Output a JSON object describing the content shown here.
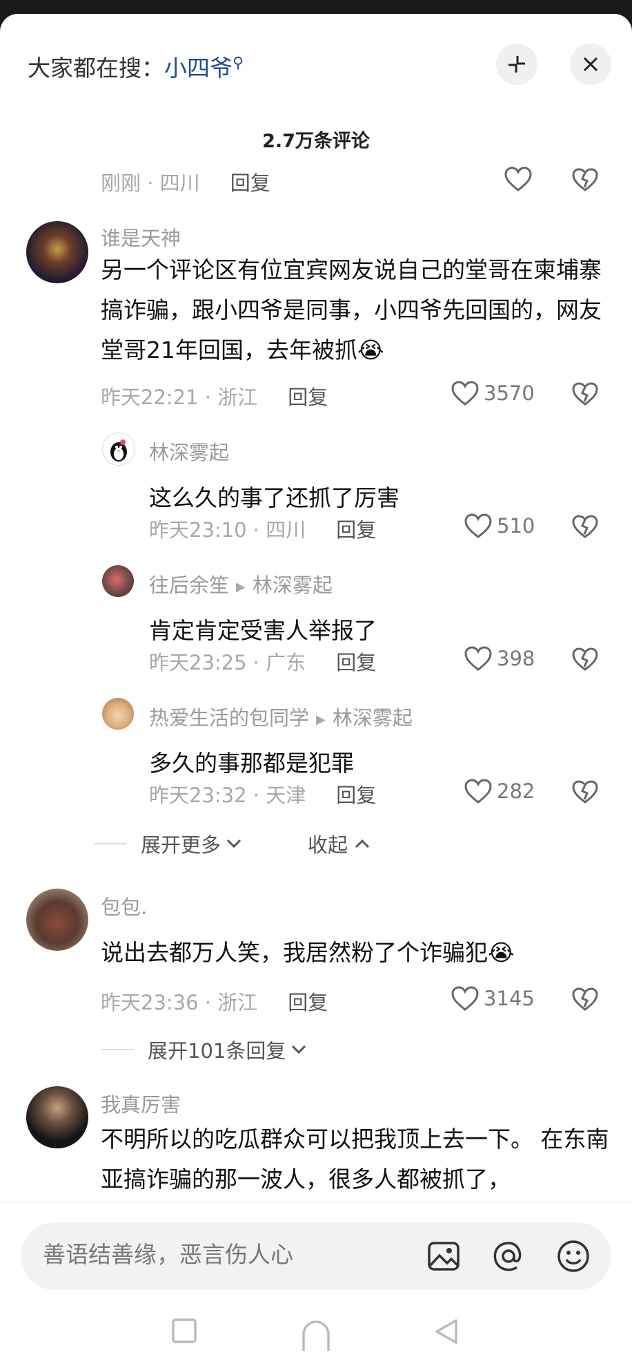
{
  "header": {
    "search_prefix": "大家都在搜：",
    "search_query": "小四爷"
  },
  "comment_count": "2.7万条评论",
  "top_meta": {
    "time": "刚刚",
    "location": "四川",
    "reply": "回复"
  },
  "comments": [
    {
      "user": "谁是天神",
      "text": "另一个评论区有位宜宾网友说自己的堂哥在柬埔寨搞诈骗，跟小四爷是同事，小四爷先回国的，网友堂哥21年回国，去年被抓",
      "emoji": "😭",
      "time": "昨天22:21",
      "location": "浙江",
      "reply": "回复",
      "likes": "3570",
      "replies": [
        {
          "user": "林深雾起",
          "reply_to": "",
          "text": "这么久的事了还抓了厉害",
          "time": "昨天23:10",
          "location": "四川",
          "reply": "回复",
          "likes": "510"
        },
        {
          "user": "往后余笙",
          "reply_to": "林深雾起",
          "text": "肯定肯定受害人举报了",
          "time": "昨天23:25",
          "location": "广东",
          "reply": "回复",
          "likes": "398"
        },
        {
          "user": "热爱生活的包同学",
          "reply_to": "林深雾起",
          "text": "多久的事那都是犯罪",
          "time": "昨天23:32",
          "location": "天津",
          "reply": "回复",
          "likes": "282"
        }
      ],
      "expand_more": "展开更多",
      "collapse": "收起"
    },
    {
      "user": "包包.",
      "text": "说出去都万人笑，我居然粉了个诈骗犯",
      "emoji": "😭",
      "time": "昨天23:36",
      "location": "浙江",
      "reply": "回复",
      "likes": "3145",
      "expand_replies": "展开101条回复"
    },
    {
      "user": "我真厉害",
      "text": "不明所以的吃瓜群众可以把我顶上去一下。 在东南亚搞诈骗的那一波人，很多人都被抓了，"
    }
  ],
  "input": {
    "placeholder": "善语结善缘，恶言伤人心"
  },
  "icons": [
    "minimize-icon",
    "close-icon",
    "heart-icon",
    "dislike-icon",
    "image-icon",
    "at-icon",
    "emoji-icon",
    "square-icon",
    "circle-icon",
    "back-icon"
  ]
}
